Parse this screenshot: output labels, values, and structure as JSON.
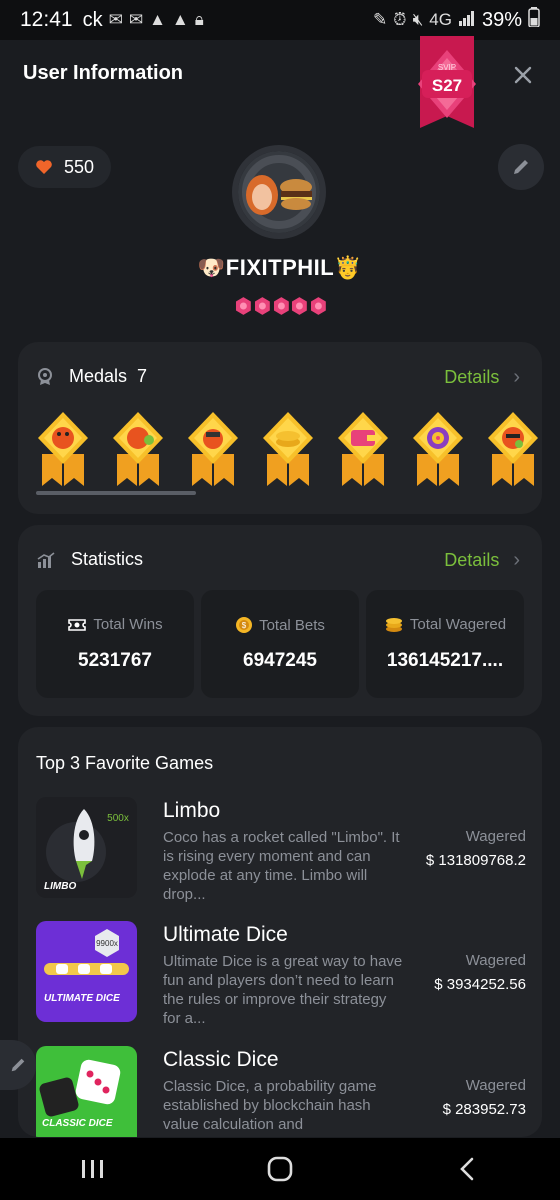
{
  "status_bar": {
    "time": "12:41",
    "carrier": "ck",
    "network": "4G",
    "battery": "39%"
  },
  "header": {
    "title": "User Information",
    "vip_small": "SVIP",
    "vip_level": "S27"
  },
  "profile": {
    "likes": "550",
    "username": "FIXITPHIL",
    "star_count": 5
  },
  "medals": {
    "label": "Medals",
    "count": "7",
    "details_label": "Details"
  },
  "statistics": {
    "label": "Statistics",
    "details_label": "Details",
    "items": [
      {
        "label": "Total Wins",
        "value": "5231767",
        "icon": "wins-ticket-icon"
      },
      {
        "label": "Total Bets",
        "value": "6947245",
        "icon": "bets-coin-icon"
      },
      {
        "label": "Total Wagered",
        "value": "136145217....",
        "icon": "wagered-stack-icon"
      }
    ]
  },
  "games": {
    "title": "Top 3 Favorite Games",
    "items": [
      {
        "name": "Limbo",
        "description": "Coco has a rocket called \"Limbo\". It is rising every moment and can explode at any time. Limbo will drop...",
        "wagered_label": "Wagered",
        "wagered_value": "$ 131809768.2",
        "thumb_text": "LIMBO",
        "thumb_badge": "500x"
      },
      {
        "name": "Ultimate Dice",
        "description": "Ultimate Dice is a great way to have fun and players don’t need to learn the rules or improve their strategy for a...",
        "wagered_label": "Wagered",
        "wagered_value": "$ 3934252.56",
        "thumb_text": "ULTIMATE DICE",
        "thumb_badge": "9900x"
      },
      {
        "name": "Classic Dice",
        "description": "Classic Dice, a probability game established by blockchain hash value calculation and",
        "wagered_label": "Wagered",
        "wagered_value": "$ 283952.73",
        "thumb_text": "CLASSIC DICE",
        "thumb_badge": ""
      }
    ]
  },
  "colors": {
    "accent_green": "#7bbf3c",
    "vip_pink": "#e0245e",
    "star_pink": "#e8417a",
    "heart_orange": "#f0652a"
  }
}
